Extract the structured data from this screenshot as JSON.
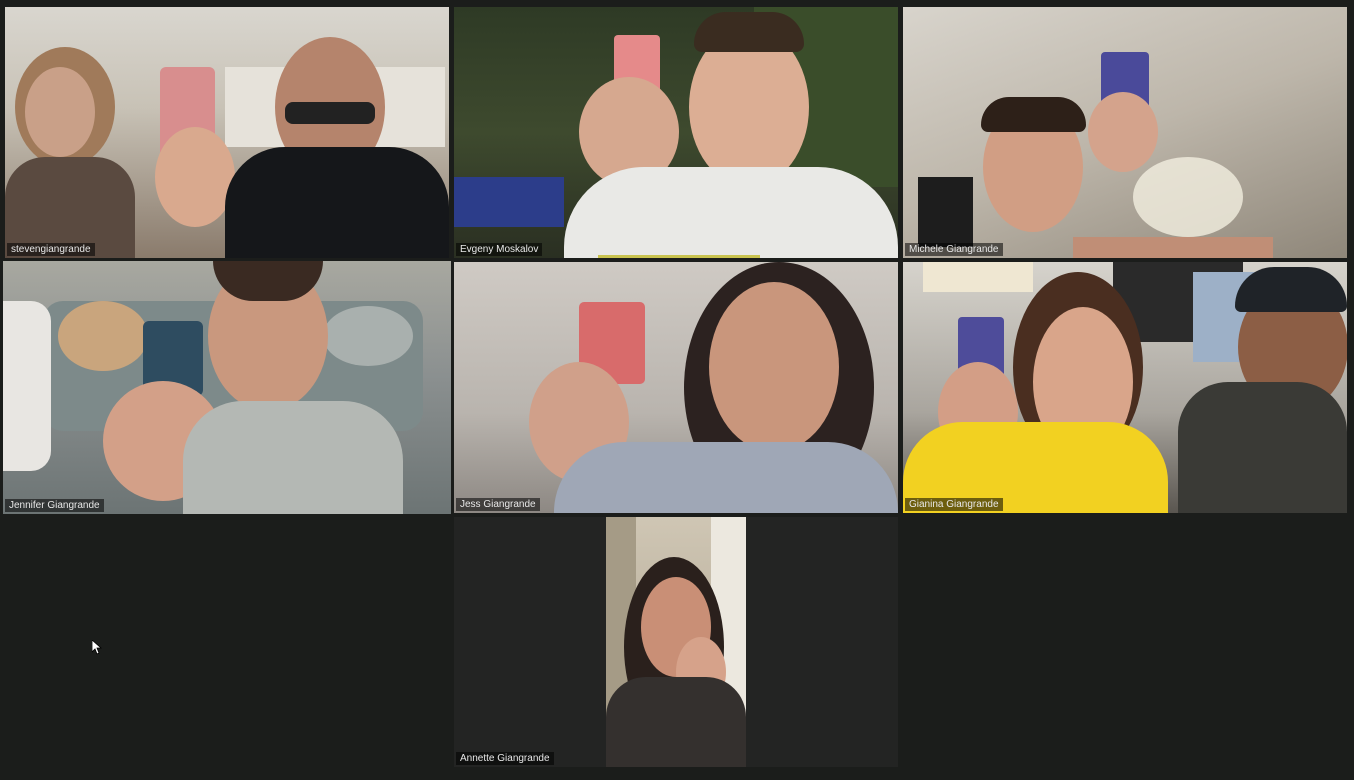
{
  "participants": [
    {
      "name": "stevengiangrande",
      "active": false
    },
    {
      "name": "Evgeny Moskalov",
      "active": false,
      "speaking": true
    },
    {
      "name": "Michele Giangrande",
      "active": false
    },
    {
      "name": "Jennifer Giangrande",
      "active": true
    },
    {
      "name": "Jess Giangrande",
      "active": false
    },
    {
      "name": "Gianina Giangrande",
      "active": false
    },
    {
      "name": "Annette Giangrande",
      "active": false
    }
  ],
  "colors": {
    "background": "#1b1d1b",
    "active_outline": "#d7d77a",
    "speaking_indicator": "#c9c34f"
  },
  "icons": {
    "cursor": "mouse-pointer-icon"
  }
}
